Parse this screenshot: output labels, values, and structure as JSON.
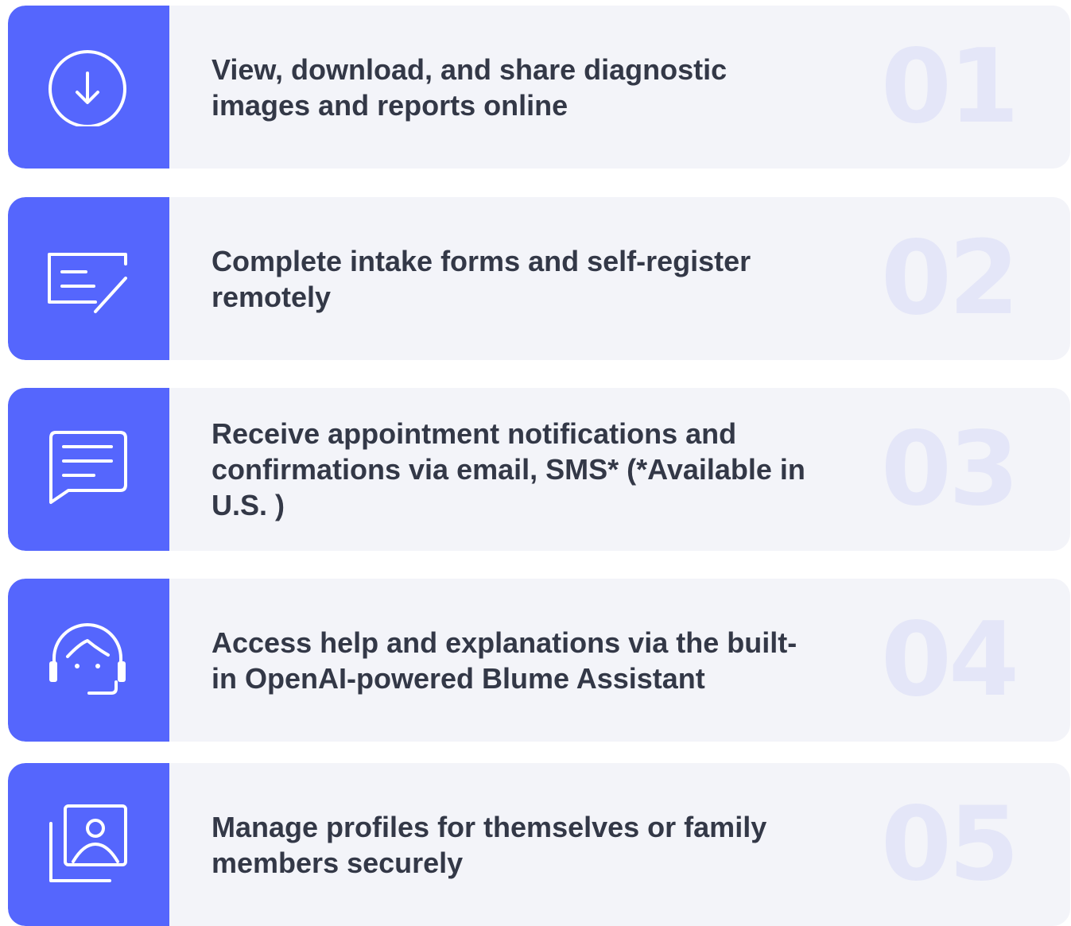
{
  "features": [
    {
      "icon": "download-icon",
      "text": "View, download, and share diagnostic images and reports online",
      "number": "01"
    },
    {
      "icon": "edit-form-icon",
      "text": "Complete intake forms and self-register remotely",
      "number": "02"
    },
    {
      "icon": "message-icon",
      "text": "Receive appointment notifications and confirmations via email,  SMS* (*Available in U.S. )",
      "number": "03"
    },
    {
      "icon": "assistant-headset-icon",
      "text": "Access help and explanations via the built-in OpenAI-powered Blume Assistant",
      "number": "04"
    },
    {
      "icon": "profile-icon",
      "text": "Manage profiles for themselves or family members securely",
      "number": "05"
    }
  ],
  "colors": {
    "accent": "#5566fd",
    "card_background": "#f3f4f9",
    "text": "#333847",
    "number": "#e4e6f8"
  }
}
